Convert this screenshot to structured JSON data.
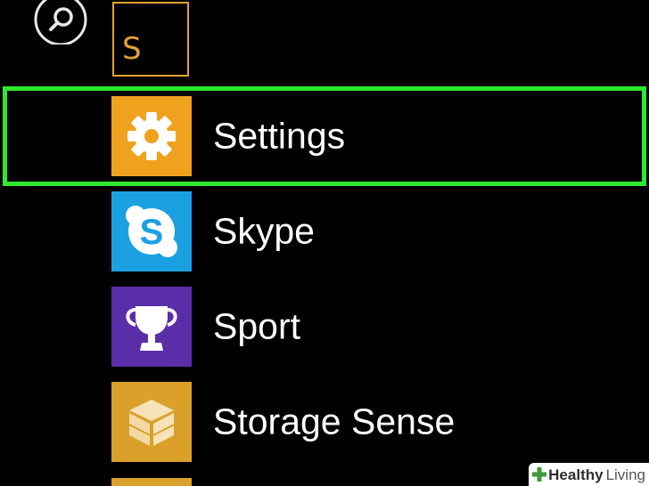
{
  "header": {
    "search_icon": "search-icon",
    "letter": "S",
    "letter_color": "#e4a22f"
  },
  "apps": [
    {
      "label": "Settings",
      "icon": "gear-icon",
      "tile_color": "#f0a21f"
    },
    {
      "label": "Skype",
      "icon": "skype-icon",
      "tile_color": "#1ba1e2"
    },
    {
      "label": "Sport",
      "icon": "trophy-icon",
      "tile_color": "#5a2ea8"
    },
    {
      "label": "Storage Sense",
      "icon": "box-icon",
      "tile_color": "#dba02a"
    }
  ],
  "highlight": {
    "target": "Settings",
    "color": "#2fe82f"
  },
  "watermark": {
    "part1": "Healthy",
    "part2": "Living",
    "icon": "plus-icon"
  }
}
